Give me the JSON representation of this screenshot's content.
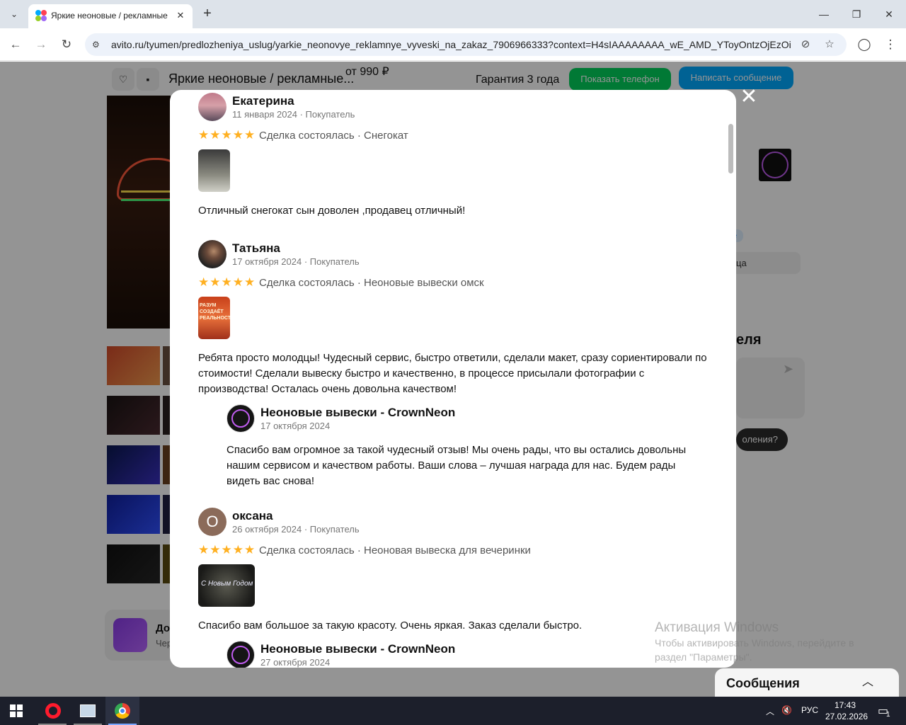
{
  "browser": {
    "tab_title": "Яркие неоновые / рекламные",
    "url": "avito.ru/tyumen/predlozheniya_uslug/yarkie_neonovye_reklamnye_vyveski_na_zakaz_7906966333?context=H4sIAAAAAAAA_wE_AMD_YToyOntzOjEzOiJsb...",
    "tab_close": "✕",
    "new_tab": "+",
    "tab_list": "⌄",
    "back": "←",
    "forward": "→",
    "reload": "↻",
    "win_min": "—",
    "win_restore": "❐",
    "win_close": "✕",
    "site_info": "⚙",
    "eye_off": "⊘",
    "star": "☆",
    "profile": "◯",
    "menu": "⋮"
  },
  "sticky": {
    "favorite": "♡",
    "note": "▪",
    "title": "Яркие неоновые / рекламные...",
    "price": "от 990 ₽",
    "guarantee": "Гарантия 3 года",
    "show_phone": "Показать телефон",
    "write_message": "Написать сообщение"
  },
  "side": {
    "chip1": "е",
    "chip2": "ца",
    "heading": "еля",
    "send_icon": "➤",
    "pill": "оления?",
    "promo_title": "До",
    "promo_sub": "Чер"
  },
  "modal": {
    "close": "✕",
    "reviews": [
      {
        "name": "Екатерина",
        "meta": "11 января 2024 · Покупатель",
        "stars": "★★★★★",
        "deal": "Сделка состоялась · Снегокат",
        "text": "Отличный снегокат сын доволен ,продавец отличный!"
      },
      {
        "name": "Татьяна",
        "meta": "17 октября 2024 · Покупатель",
        "stars": "★★★★★",
        "deal": "Сделка состоялась · Неоновые вывески омск",
        "photo_text": "РАЗУМ СОЗДАЁТ РЕАЛЬНОСТЬ",
        "text": "Ребята просто молодцы! Чудесный сервис, быстро ответили, сделали макет, сразу сориентировали по стоимости! Сделали вывеску быстро и качественно, в процессе присылали фотографии с производства! Осталась очень довольна качеством!",
        "reply": {
          "name": "Неоновые вывески - CrownNeon",
          "date": "17 октября 2024",
          "text": "Спасибо вам огромное за такой чудесный отзыв! Мы очень рады, что вы остались довольны нашим сервисом и качеством работы. Ваши слова – лучшая награда для нас. Будем рады видеть вас снова!"
        }
      },
      {
        "name": "оксана",
        "avatar_letter": "О",
        "meta": "26 октября 2024 · Покупатель",
        "stars": "★★★★★",
        "deal": "Сделка состоялась · Неоновая вывеска для вечеринки",
        "photo_text": "С Новым Годом",
        "text": "Спасибо вам большое за такую красоту. Очень яркая. Заказ сделали быстро.",
        "reply": {
          "name": "Неоновые вывески - CrownNeon",
          "date": "27 октября 2024"
        }
      }
    ]
  },
  "watermark": {
    "line1": "Активация Windows",
    "line2": "Чтобы активировать Windows, перейдите в",
    "line3": "раздел \"Параметры\"."
  },
  "messages_bar": {
    "label": "Сообщения",
    "chevron": "︿"
  },
  "taskbar": {
    "tray_arrow": "︿",
    "volume": "🔇",
    "lang": "РУС",
    "time": "17:43",
    "date": "27.02.2026",
    "notif": "▭",
    "notif_count": "1"
  },
  "colors": {
    "avito_green": "#02d15c",
    "avito_blue": "#00aaff",
    "star": "#ffb021"
  }
}
